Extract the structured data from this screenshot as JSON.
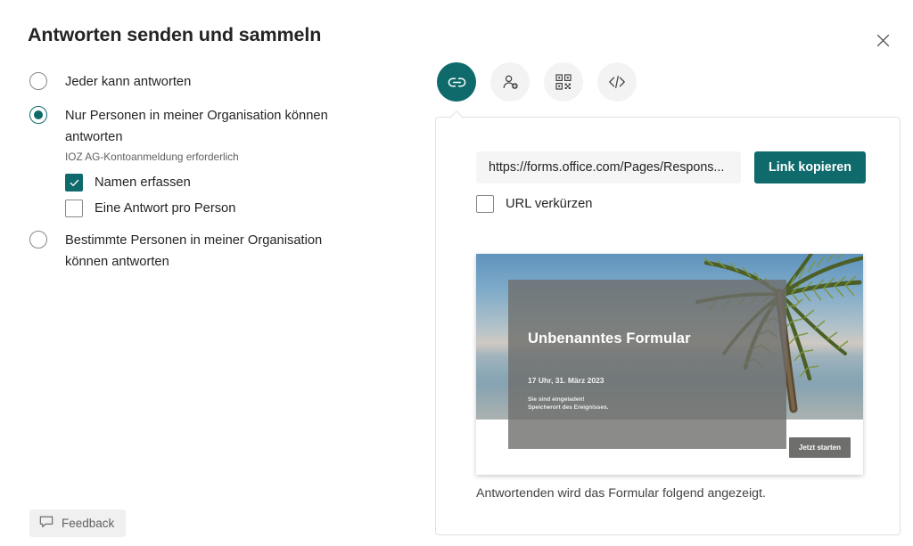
{
  "header": {
    "title": "Antworten senden und sammeln",
    "close_icon": "close-icon"
  },
  "audience": {
    "options": [
      {
        "label": "Jeder kann antworten",
        "selected": false,
        "sublabel": ""
      },
      {
        "label": "Nur Personen in meiner Organisation können antworten",
        "selected": true,
        "sublabel": "IOZ AG-Kontoanmeldung erforderlich"
      },
      {
        "label": "Bestimmte Personen in meiner Organisation können antworten",
        "selected": false,
        "sublabel": ""
      }
    ],
    "checkboxes": [
      {
        "label": "Namen erfassen",
        "checked": true
      },
      {
        "label": "Eine Antwort pro Person",
        "checked": false
      }
    ]
  },
  "feedback": {
    "label": "Feedback",
    "icon": "comment-icon"
  },
  "share": {
    "tabs": [
      {
        "name": "link",
        "icon": "link-icon",
        "active": true
      },
      {
        "name": "invite-people",
        "icon": "person-add-icon",
        "active": false
      },
      {
        "name": "qr-code",
        "icon": "qr-code-icon",
        "active": false
      },
      {
        "name": "embed",
        "icon": "code-icon",
        "active": false
      }
    ],
    "url_value": "https://forms.office.com/Pages/Respons...",
    "copy_button": "Link kopieren",
    "shorten_label": "URL verkürzen",
    "shorten_checked": false,
    "caption": "Antwortenden wird das Formular folgend angezeigt."
  },
  "preview": {
    "form_title": "Unbenanntes Formular",
    "date_line": "17 Uhr, 31. März 2023",
    "invite_line": "Sie sind eingeladen!",
    "location_line": "Speicherort des Ereignisses.",
    "start_button": "Jetzt starten"
  },
  "colors": {
    "accent": "#0f6a6c",
    "text": "#242424",
    "muted": "#616161",
    "panel_border": "#e1e1e1",
    "field_bg": "#f5f5f5"
  }
}
